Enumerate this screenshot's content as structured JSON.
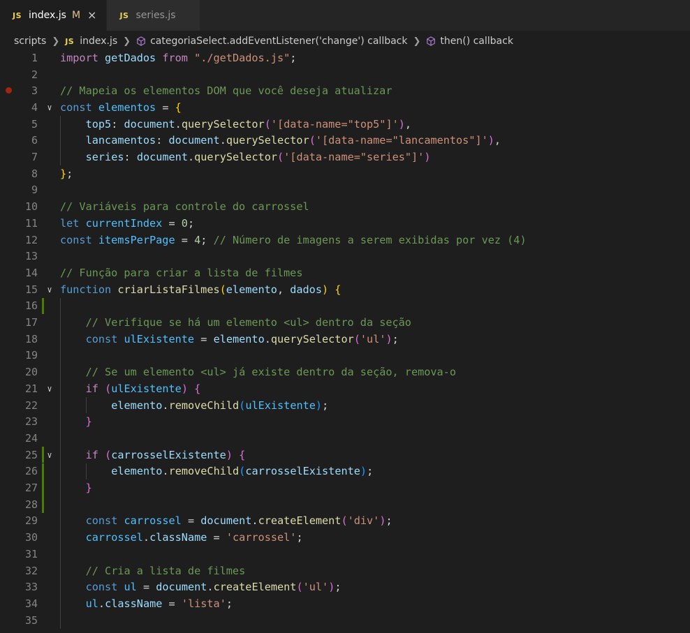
{
  "tabs": [
    {
      "icon": "JS",
      "label": "index.js",
      "status": "M",
      "close": "×",
      "active": true
    },
    {
      "icon": "JS",
      "label": "series.js",
      "active": false
    }
  ],
  "breadcrumb": {
    "folder": "scripts",
    "file_icon": "JS",
    "file": "index.js",
    "symbol1": "categoriaSelect.addEventListener('change') callback",
    "symbol2": "then() callback"
  },
  "colors": {
    "background": "#1e1e1e",
    "keyword": "#569cd6",
    "control": "#c586c0",
    "variable": "#9cdcfe",
    "function": "#dcdcaa",
    "string": "#ce9178",
    "comment": "#6a9955",
    "added_marker": "#487e02",
    "breakpoint": "#a1260d"
  },
  "lines": [
    {
      "n": "1",
      "text": "import getDados from \"./getDados.js\";"
    },
    {
      "n": "2",
      "text": ""
    },
    {
      "n": "3",
      "text": "// Mapeia os elementos DOM que você deseja atualizar"
    },
    {
      "n": "4",
      "text": "const elementos = {"
    },
    {
      "n": "5",
      "text": "    top5: document.querySelector('[data-name=\"top5\"]'),"
    },
    {
      "n": "6",
      "text": "    lancamentos: document.querySelector('[data-name=\"lancamentos\"]'),"
    },
    {
      "n": "7",
      "text": "    series: document.querySelector('[data-name=\"series\"]')"
    },
    {
      "n": "8",
      "text": "};"
    },
    {
      "n": "9",
      "text": ""
    },
    {
      "n": "10",
      "text": "// Variáveis para controle do carrossel"
    },
    {
      "n": "11",
      "text": "let currentIndex = 0;"
    },
    {
      "n": "12",
      "text": "const itemsPerPage = 4; // Número de imagens a serem exibidas por vez (4)"
    },
    {
      "n": "13",
      "text": ""
    },
    {
      "n": "14",
      "text": "// Função para criar a lista de filmes"
    },
    {
      "n": "15",
      "text": "function criarListaFilmes(elemento, dados) {"
    },
    {
      "n": "16",
      "text": ""
    },
    {
      "n": "17",
      "text": "    // Verifique se há um elemento <ul> dentro da seção"
    },
    {
      "n": "18",
      "text": "    const ulExistente = elemento.querySelector('ul');"
    },
    {
      "n": "19",
      "text": ""
    },
    {
      "n": "20",
      "text": "    // Se um elemento <ul> já existe dentro da seção, remova-o"
    },
    {
      "n": "21",
      "text": "    if (ulExistente) {"
    },
    {
      "n": "22",
      "text": "        elemento.removeChild(ulExistente);"
    },
    {
      "n": "23",
      "text": "    }"
    },
    {
      "n": "24",
      "text": ""
    },
    {
      "n": "25",
      "text": "    if (carrosselExistente) {"
    },
    {
      "n": "26",
      "text": "        elemento.removeChild(carrosselExistente);"
    },
    {
      "n": "27",
      "text": "    }"
    },
    {
      "n": "28",
      "text": ""
    },
    {
      "n": "29",
      "text": "    const carrossel = document.createElement('div');"
    },
    {
      "n": "30",
      "text": "    carrossel.className = 'carrossel';"
    },
    {
      "n": "31",
      "text": ""
    },
    {
      "n": "32",
      "text": "    // Cria a lista de filmes"
    },
    {
      "n": "33",
      "text": "    const ul = document.createElement('ul');"
    },
    {
      "n": "34",
      "text": "    ul.className = 'lista';"
    },
    {
      "n": "35",
      "text": ""
    }
  ]
}
